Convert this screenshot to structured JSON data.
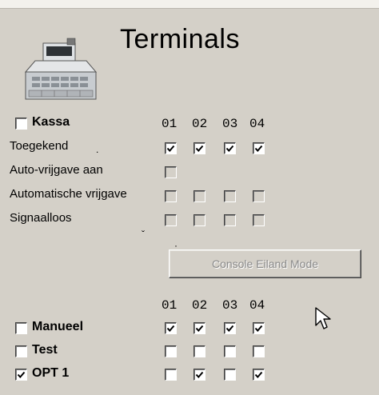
{
  "title": "Terminals",
  "kassa": {
    "label": "Kassa",
    "checked": false,
    "columns": [
      "01",
      "02",
      "03",
      "04"
    ],
    "rows": [
      {
        "label": "Toegekend",
        "cells": [
          true,
          true,
          true,
          true
        ],
        "count": 4
      },
      {
        "label": "Auto-vrijgave aan",
        "cells": [
          false
        ],
        "count": 1
      },
      {
        "label": "Automatische vrijgave",
        "cells": [
          false,
          false,
          false,
          false
        ],
        "count": 4,
        "disabled": true
      },
      {
        "label": "Signaalloos",
        "cells": [
          false,
          false,
          false,
          false
        ],
        "count": 4,
        "disabled": true
      }
    ]
  },
  "button": {
    "label": "Console Eiland Mode",
    "enabled": false
  },
  "modes": {
    "columns": [
      "01",
      "02",
      "03",
      "04"
    ],
    "rows": [
      {
        "label": "Manueel",
        "checked": false,
        "cells": [
          true,
          true,
          true,
          true
        ]
      },
      {
        "label": "Test",
        "checked": false,
        "cells": [
          false,
          false,
          false,
          false
        ]
      },
      {
        "label": "OPT 1",
        "checked": true,
        "cells": [
          false,
          true,
          false,
          true
        ]
      }
    ]
  },
  "icons": {
    "header": "cash-register-icon",
    "pointer": "mouse-cursor-icon"
  }
}
